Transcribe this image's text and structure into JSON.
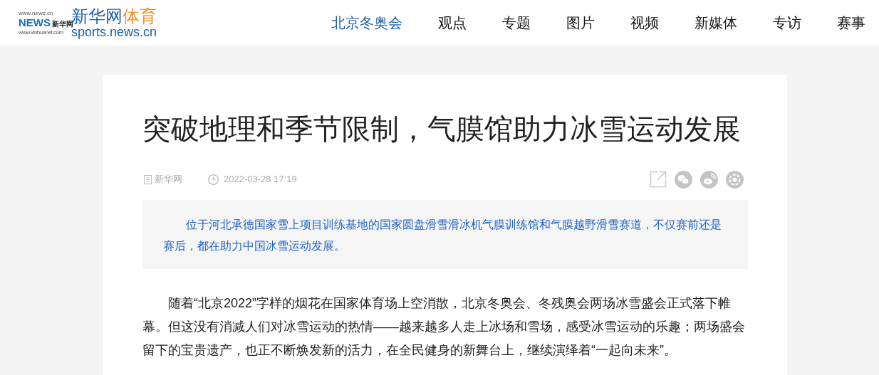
{
  "logo": {
    "mark_top": "www.news.cn",
    "mark_name": "新华网",
    "mark_letters": "NEWS",
    "mark_bottom": "www.xinhuanet.com",
    "site_name": "新华网",
    "site_section": "体育",
    "site_url": "sports.news.cn"
  },
  "nav": [
    {
      "label": "北京冬奥会",
      "selected": true
    },
    {
      "label": "观点",
      "selected": false
    },
    {
      "label": "专题",
      "selected": false
    },
    {
      "label": "图片",
      "selected": false
    },
    {
      "label": "视频",
      "selected": false
    },
    {
      "label": "新媒体",
      "selected": false
    },
    {
      "label": "专访",
      "selected": false
    },
    {
      "label": "赛事",
      "selected": false
    }
  ],
  "article": {
    "title": "突破地理和季节限制，气膜馆助力冰雪运动发展",
    "source": "新华网",
    "time": "2022-03-28 17:19",
    "summary": "位于河北承德国家雪上项目训练基地的国家圆盘滑雪滑冰机气膜训练馆和气膜越野滑雪赛道，不仅赛前还是赛后，都在助力中国冰雪运动发展。",
    "body": "随着“北京2022”字样的烟花在国家体育场上空消散，北京冬奥会、冬残奥会两场冰雪盛会正式落下帷幕。但这没有消减人们对冰雪运动的热情——越来越多人走上冰场和雪场，感受冰雪运动的乐趣；两场盛会留下的宝贵遗产，也正不断焕发新的活力，在全民健身的新舞台上，继续演绎着“一起向未来”。"
  }
}
